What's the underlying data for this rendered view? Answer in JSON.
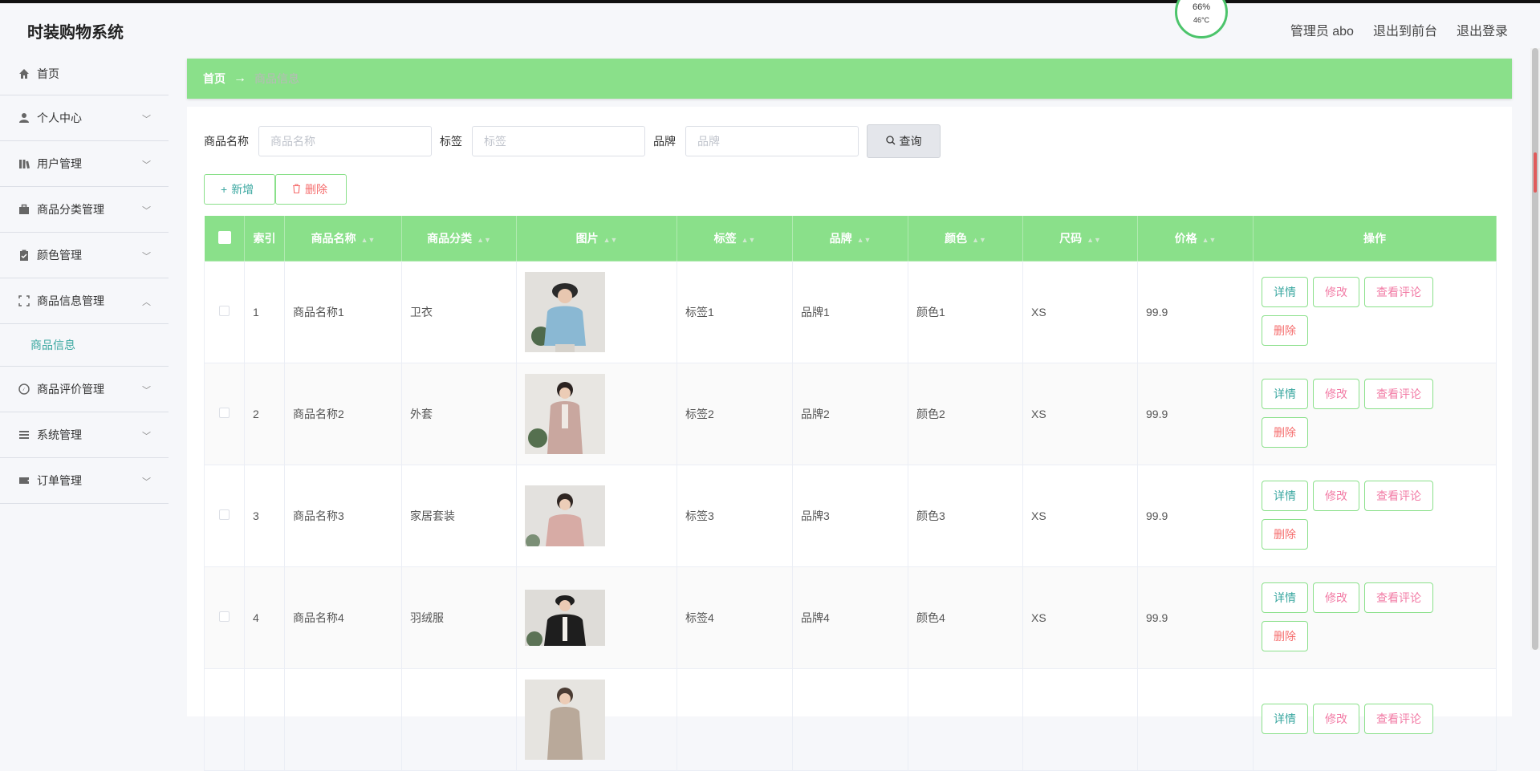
{
  "app_title": "时装购物系统",
  "header": {
    "admin": "管理员 abo",
    "to_front": "退出到前台",
    "logout": "退出登录",
    "gauge_temp": "46°C",
    "gauge_pct": "66%"
  },
  "sidebar": {
    "items": [
      {
        "label": "首页",
        "icon": "home-icon"
      },
      {
        "label": "个人中心",
        "icon": "user-icon"
      },
      {
        "label": "用户管理",
        "icon": "users-icon"
      },
      {
        "label": "商品分类管理",
        "icon": "briefcase-icon"
      },
      {
        "label": "颜色管理",
        "icon": "clipboard-icon"
      },
      {
        "label": "商品信息管理",
        "icon": "expand-icon"
      },
      {
        "label": "商品评价管理",
        "icon": "compass-icon"
      },
      {
        "label": "系统管理",
        "icon": "menu-icon"
      },
      {
        "label": "订单管理",
        "icon": "ticket-icon"
      }
    ],
    "sub_item": "商品信息"
  },
  "breadcrumb": {
    "home": "首页",
    "arrow": "→",
    "current": "商品信息"
  },
  "search": {
    "name_label": "商品名称",
    "name_placeholder": "商品名称",
    "tag_label": "标签",
    "tag_placeholder": "标签",
    "brand_label": "品牌",
    "brand_placeholder": "品牌",
    "query_label": "查询"
  },
  "actions": {
    "add": "新增",
    "delete": "删除"
  },
  "table": {
    "headers": [
      "索引",
      "商品名称",
      "商品分类",
      "图片",
      "标签",
      "品牌",
      "颜色",
      "尺码",
      "价格",
      "操作"
    ],
    "rows": [
      {
        "index": "1",
        "name": "商品名称1",
        "category": "卫衣",
        "image": "model-blue-hoodie",
        "tag": "标签1",
        "brand": "品牌1",
        "color": "颜色1",
        "size": "XS",
        "price": "99.9"
      },
      {
        "index": "2",
        "name": "商品名称2",
        "category": "外套",
        "image": "model-pink-coat",
        "tag": "标签2",
        "brand": "品牌2",
        "color": "颜色2",
        "size": "XS",
        "price": "99.9"
      },
      {
        "index": "3",
        "name": "商品名称3",
        "category": "家居套装",
        "image": "model-pink-homewear",
        "tag": "标签3",
        "brand": "品牌3",
        "color": "颜色3",
        "size": "XS",
        "price": "99.9"
      },
      {
        "index": "4",
        "name": "商品名称4",
        "category": "羽绒服",
        "image": "model-black-down",
        "tag": "标签4",
        "brand": "品牌4",
        "color": "颜色4",
        "size": "XS",
        "price": "99.9"
      }
    ],
    "ops": {
      "detail": "详情",
      "edit": "修改",
      "comments": "查看评论",
      "remove": "删除"
    }
  },
  "colors": {
    "accent": "#8ae08a",
    "teal": "#3aa7a0",
    "pink": "#f27ba5",
    "red": "#f56c6c"
  }
}
